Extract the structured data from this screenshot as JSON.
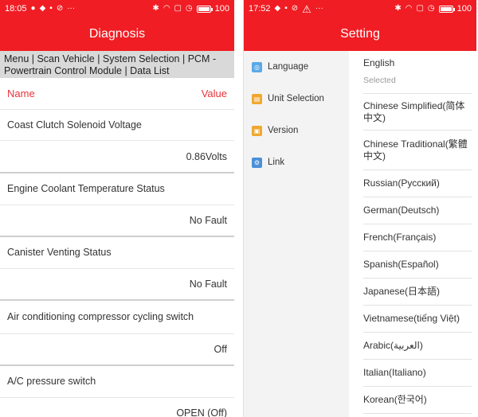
{
  "left": {
    "status": {
      "time": "18:05",
      "battery": "100"
    },
    "title": "Diagnosis",
    "breadcrumb": "Menu | Scan Vehicle | System Selection | PCM - Powertrain Control Module | Data List",
    "columns": {
      "name": "Name",
      "value": "Value"
    },
    "rows": [
      {
        "name": "Coast Clutch Solenoid Voltage",
        "value": "0.86Volts"
      },
      {
        "name": "Engine Coolant Temperature Status",
        "value": "No Fault"
      },
      {
        "name": "Canister Venting Status",
        "value": "No Fault"
      },
      {
        "name": "Air conditioning compressor cycling switch",
        "value": "Off"
      },
      {
        "name": "A/C pressure switch",
        "value": "OPEN (Off)"
      }
    ]
  },
  "right": {
    "status": {
      "time": "17:52",
      "battery": "100"
    },
    "title": "Setting",
    "nav": [
      {
        "label": "Language",
        "icon": "language-icon",
        "color": "#5aa9e6"
      },
      {
        "label": "Unit Selection",
        "icon": "unit-icon",
        "color": "#f0a830"
      },
      {
        "label": "Version",
        "icon": "version-icon",
        "color": "#f0a830"
      },
      {
        "label": "Link",
        "icon": "link-icon",
        "color": "#4a90d9"
      }
    ],
    "languages": [
      {
        "label": "English",
        "sub": "Selected"
      },
      {
        "label": "Chinese Simplified(简体中文)"
      },
      {
        "label": "Chinese Traditional(繁體中文)"
      },
      {
        "label": "Russian(Русский)"
      },
      {
        "label": "German(Deutsch)"
      },
      {
        "label": "French(Français)"
      },
      {
        "label": "Spanish(Español)"
      },
      {
        "label": "Japanese(日本語)"
      },
      {
        "label": "Vietnamese(tiếng Việt)"
      },
      {
        "label": "Arabic(العربية)"
      },
      {
        "label": "Italian(Italiano)"
      },
      {
        "label": "Korean(한국어)"
      }
    ]
  }
}
